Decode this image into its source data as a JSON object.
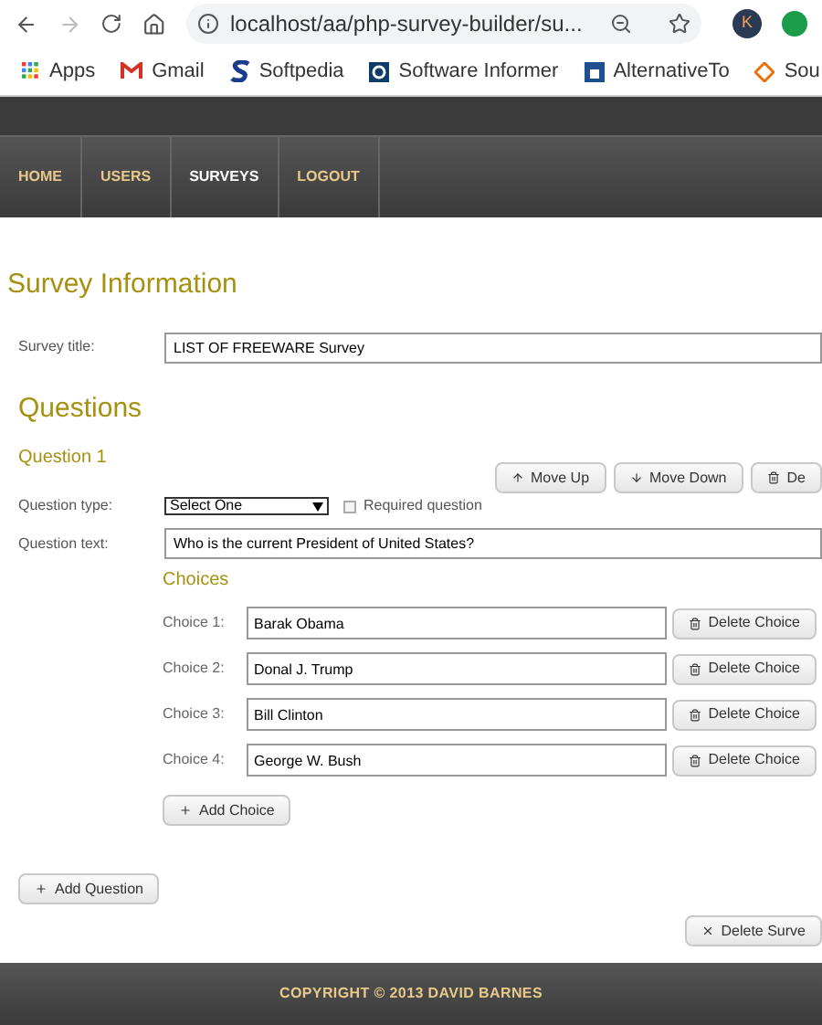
{
  "browser": {
    "back_disabled": false,
    "forward_disabled": true,
    "url": "localhost/aa/php-survey-builder/su...",
    "avatar": "K",
    "bookmarks": [
      {
        "kind": "apps",
        "label": "Apps"
      },
      {
        "kind": "gmail",
        "label": "Gmail"
      },
      {
        "kind": "softpedia",
        "label": "Softpedia"
      },
      {
        "kind": "informer",
        "label": "Software Informer"
      },
      {
        "kind": "alternative",
        "label": "AlternativeTo"
      },
      {
        "kind": "diamond",
        "label": "Sou"
      }
    ]
  },
  "nav": [
    {
      "label": "HOME",
      "selected": false
    },
    {
      "label": "USERS",
      "selected": false
    },
    {
      "label": "SURVEYS",
      "selected": true
    },
    {
      "label": "LOGOUT",
      "selected": false
    }
  ],
  "survey_info": {
    "heading": "Survey Information",
    "title_label": "Survey title:",
    "title_value": "LIST OF FREEWARE Survey"
  },
  "questions": {
    "heading": "Questions",
    "question_heading": "Question 1",
    "buttons": [
      {
        "kind": "up",
        "label": "Move Up"
      },
      {
        "kind": "down",
        "label": "Move Down"
      },
      {
        "kind": "delete",
        "label": "De"
      }
    ],
    "type_label": "Question type:",
    "type_value": "Select One",
    "required_label": "Required question",
    "required_checked": false,
    "text_label": "Question text:",
    "text_value": "Who is the current President of United States?",
    "choices_heading": "Choices",
    "choices": [
      {
        "label": "Choice 1:",
        "value": "Barak Obama",
        "delete": "Delete Choice"
      },
      {
        "label": "Choice 2:",
        "value": "Donal J. Trump",
        "delete": "Delete Choice"
      },
      {
        "label": "Choice 3:",
        "value": "Bill Clinton",
        "delete": "Delete Choice"
      },
      {
        "label": "Choice 4:",
        "value": "George W. Bush",
        "delete": "Delete Choice"
      }
    ],
    "add_choice": "Add Choice"
  },
  "add_question": "Add Question",
  "delete_survey": "Delete Surve",
  "footer": "COPYRIGHT © 2013 DAVID BARNES"
}
